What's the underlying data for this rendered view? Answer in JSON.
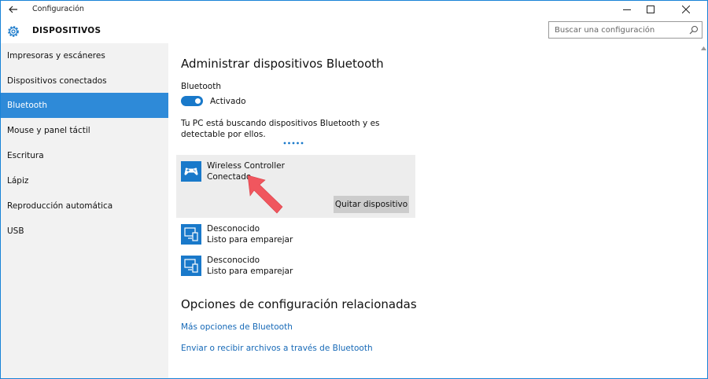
{
  "window": {
    "title": "Configuración"
  },
  "header": {
    "title": "DISPOSITIVOS",
    "search_placeholder": "Buscar una configuración"
  },
  "sidebar": {
    "items": [
      {
        "label": "Impresoras y escáneres",
        "active": false
      },
      {
        "label": "Dispositivos conectados",
        "active": false
      },
      {
        "label": "Bluetooth",
        "active": true
      },
      {
        "label": "Mouse y panel táctil",
        "active": false
      },
      {
        "label": "Escritura",
        "active": false
      },
      {
        "label": "Lápiz",
        "active": false
      },
      {
        "label": "Reproducción automática",
        "active": false
      },
      {
        "label": "USB",
        "active": false
      }
    ]
  },
  "main": {
    "title": "Administrar dispositivos Bluetooth",
    "bluetooth_label": "Bluetooth",
    "toggle_state": "Activado",
    "description": "Tu PC está buscando dispositivos Bluetooth y es detectable por ellos.",
    "devices": [
      {
        "name": "Wireless Controller",
        "status": "Conectado",
        "icon": "gamepad-icon"
      },
      {
        "name": "Desconocido",
        "status": "Listo para emparejar",
        "icon": "device-icon"
      },
      {
        "name": "Desconocido",
        "status": "Listo para emparejar",
        "icon": "device-icon"
      }
    ],
    "remove_button": "Quitar dispositivo",
    "related_title": "Opciones de configuración relacionadas",
    "links": [
      "Más opciones de Bluetooth",
      "Enviar o recibir archivos a través de Bluetooth"
    ]
  },
  "colors": {
    "accent": "#2e8ad8",
    "toggle": "#1979ca",
    "link": "#1669b7",
    "annotation_arrow": "#f0565e"
  }
}
